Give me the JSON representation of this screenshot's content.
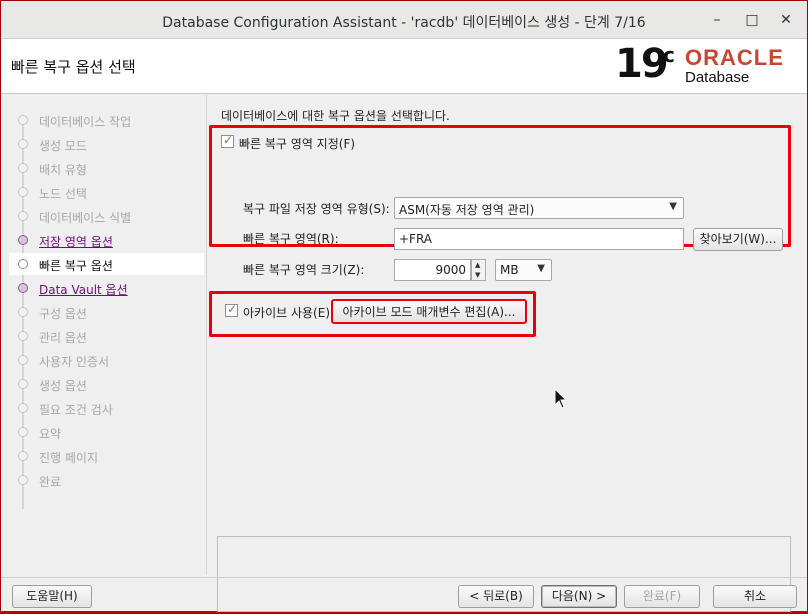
{
  "window": {
    "title": "Database Configuration Assistant - 'racdb' 데이터베이스 생성 - 단계 7/16",
    "controls": [
      "–",
      "□",
      "✕"
    ]
  },
  "header": {
    "page_title": "빠른 복구 옵션 선택",
    "logo_version": "19",
    "logo_superscript": "c",
    "logo_brand": "ORACLE",
    "logo_product": "Database"
  },
  "sidebar": {
    "items": [
      {
        "label": "데이터베이스 작업",
        "state": "disabled"
      },
      {
        "label": "생성 모드",
        "state": "disabled"
      },
      {
        "label": "배치 유형",
        "state": "disabled"
      },
      {
        "label": "노드 선택",
        "state": "disabled"
      },
      {
        "label": "데이터베이스 식별",
        "state": "disabled"
      },
      {
        "label": "저장 영역 옵션",
        "state": "link"
      },
      {
        "label": "빠른 복구 옵션",
        "state": "active"
      },
      {
        "label": "Data Vault 옵션",
        "state": "link"
      },
      {
        "label": "구성 옵션",
        "state": "disabled"
      },
      {
        "label": "관리 옵션",
        "state": "disabled"
      },
      {
        "label": "사용자 인증서",
        "state": "disabled"
      },
      {
        "label": "생성 옵션",
        "state": "disabled"
      },
      {
        "label": "필요 조건 검사",
        "state": "disabled"
      },
      {
        "label": "요약",
        "state": "disabled"
      },
      {
        "label": "진행 페이지",
        "state": "disabled"
      },
      {
        "label": "완료",
        "state": "disabled"
      }
    ]
  },
  "main": {
    "intro": "데이터베이스에 대한 복구 옵션을 선택합니다.",
    "fra_checkbox_label": "빠른 복구 영역 지정(F)",
    "fra_checked": true,
    "storage_type_label": "복구 파일 저장 영역 유형(S):",
    "storage_type_value": "ASM(자동 저장 영역 관리)",
    "fra_location_label": "빠른 복구 영역(R):",
    "fra_location_value": "+FRA",
    "browse_button": "찾아보기(W)...",
    "fra_size_label": "빠른 복구 영역 크기(Z):",
    "fra_size_value": "9000",
    "fra_size_unit": "MB",
    "archive_checkbox_label": "아카이브 사용(E)",
    "archive_checked": true,
    "archive_edit_button": "아카이브 모드 매개변수 편집(A)..."
  },
  "footer": {
    "help_button": "도움말(H)",
    "back_button": "< 뒤로(B)",
    "next_button": "다음(N) >",
    "finish_button": "완료(F)",
    "cancel_button": "취소"
  },
  "colors": {
    "highlight_box": "#e8000b",
    "oracle_red": "#c74634",
    "link": "#6b0f76",
    "check": "#4a9b2f"
  }
}
